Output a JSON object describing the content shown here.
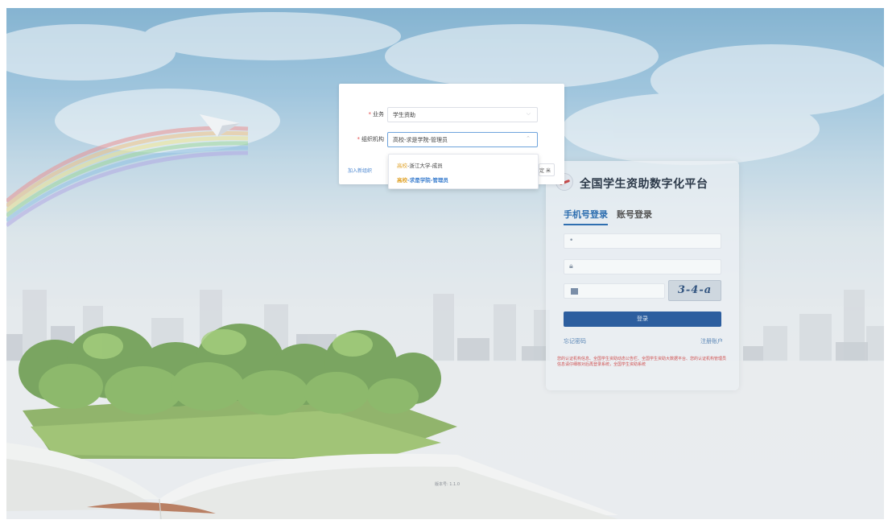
{
  "modal": {
    "business_label": "业务",
    "business_value": "学生资助",
    "org_label": "组织机构",
    "org_value": "高校-求是学院-管理员",
    "join_link": "加入新组织",
    "confirm_label": "定 米"
  },
  "dropdown": {
    "items": [
      {
        "type": "高校",
        "text": "-浙江大学-成员"
      },
      {
        "type": "高校",
        "text": "-求是学院-管理员"
      }
    ]
  },
  "login": {
    "title": "全国学生资助数字化平台",
    "tab_phone": "手机号登录",
    "tab_account": "账号登录",
    "captcha": "3-4-a",
    "submit_label": "登录",
    "forgot_link": "忘记密码",
    "register_link": "注册账户",
    "notice": "您的认证机构信息、全国学生资助动态公告栏、全国学生资助大数据平台、您的认证机构管理员信息请仔细核对后再登录系统，全国学生资助系统"
  },
  "footer": {
    "version": "版本号: 1.1.0"
  },
  "colors": {
    "primary": "#2d5e9f",
    "link": "#3d7fcf",
    "required": "#e34d4d",
    "highlight": "#e0a32b"
  },
  "icons": [
    "lock-icon",
    "phone-icon",
    "chevron-down-icon",
    "chevron-up-icon",
    "paper-plane-icon",
    "logo-icon"
  ]
}
